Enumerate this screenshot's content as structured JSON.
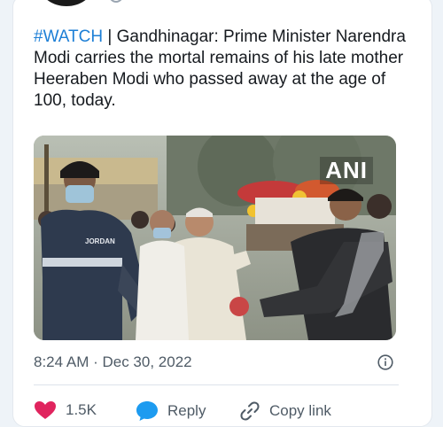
{
  "tweet": {
    "hashtag": "#WATCH",
    "text": " | Gandhinagar: Prime Minister Narendra Modi carries the mortal remains of his late mother Heeraben Modi who passed away at the age of 100, today."
  },
  "media": {
    "watermark": "ANI",
    "shirt_text": "JORDAN"
  },
  "meta": {
    "timestamp": "8:24 AM · Dec 30, 2022",
    "info_icon": "info-circle-icon"
  },
  "actions": {
    "like_count": "1.5K",
    "reply_label": "Reply",
    "copy_link_label": "Copy link"
  },
  "colors": {
    "link": "#1d7fd6",
    "like": "#e0245e",
    "reply": "#1d9bf0"
  }
}
